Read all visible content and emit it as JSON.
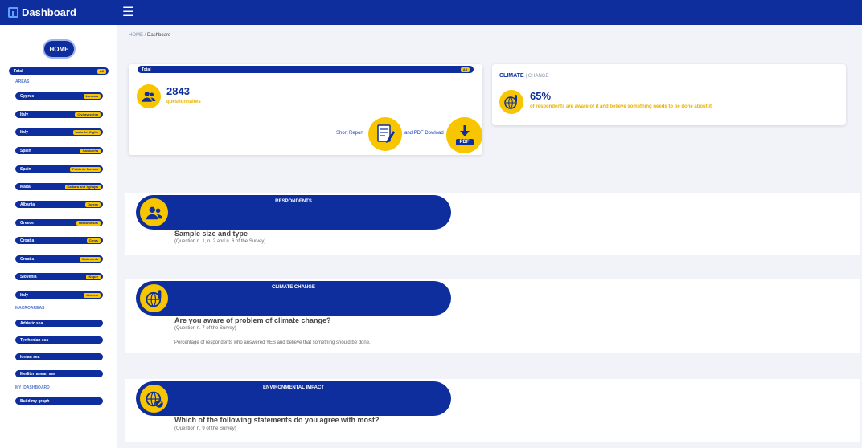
{
  "app": {
    "title": "Dashboard"
  },
  "sidebar": {
    "home_label": "HOME",
    "total": {
      "label": "Total",
      "badge": "All"
    },
    "areas_heading": "AREAS",
    "areas": [
      {
        "label": "Cyprus",
        "badge": "Larnaca"
      },
      {
        "label": "Italy",
        "badge": "Civitavecchia"
      },
      {
        "label": "Italy",
        "badge": "Isola del Giglio"
      },
      {
        "label": "Spain",
        "badge": "Salobreña"
      },
      {
        "label": "Spain",
        "badge": "Polda de Farnals"
      },
      {
        "label": "Malta",
        "badge": "Kalkara and Xghajra"
      },
      {
        "label": "Albania",
        "badge": "Durres"
      },
      {
        "label": "Greece",
        "badge": "Hersonissos"
      },
      {
        "label": "Croatia",
        "badge": "Črnes"
      },
      {
        "label": "Croatia",
        "badge": "Dubrovnik"
      },
      {
        "label": "Slovenia",
        "badge": "Koper"
      },
      {
        "label": "Italy",
        "badge": "Livorno"
      }
    ],
    "macroareas_heading": "MACROAREAS",
    "macroareas": [
      {
        "label": "Adriatic sea"
      },
      {
        "label": "Tyrrhenian sea"
      },
      {
        "label": "Ionian sea"
      },
      {
        "label": "Mediterranean sea"
      }
    ],
    "my_dashboard_heading": "MY_DASHBOARD",
    "build_graph": "Build my graph"
  },
  "breadcrumb": {
    "home": "HOME",
    "sep": "/",
    "current": "Dashboard"
  },
  "total_card": {
    "bar_label": "Total",
    "bar_badge": "All",
    "count": "2843",
    "count_label": "questionnaires",
    "short_report": "Short Report",
    "pdf_download": "and PDF Dowload",
    "pdf_icon_text": "PDF"
  },
  "climate_card": {
    "title": "CLIMATE",
    "subtitle": "| CHANGE",
    "percent": "65%",
    "description": "of respondents are aware of it and believe something needs to be done about it"
  },
  "sections": [
    {
      "banner": "RESPONDENTS",
      "title": "Sample size and type",
      "question": "(Question n. 1, n. 2 and n. 6 of the Survey)",
      "note": ""
    },
    {
      "banner": "CLIMATE CHANGE",
      "title": "Are you aware of problem of climate change?",
      "question": "(Question n. 7 of the Survey)",
      "note": "Percentage of respondents who answered YES and believe that something should be done."
    },
    {
      "banner": "ENVIRONMENTAL IMPACT",
      "title": "Which of the following statements do you agree with most?",
      "question": "(Question n. 9 of the Survey)",
      "note": ""
    }
  ],
  "colors": {
    "primary": "#0d2e9c",
    "accent": "#f7c600",
    "background": "#f1f3f9"
  }
}
